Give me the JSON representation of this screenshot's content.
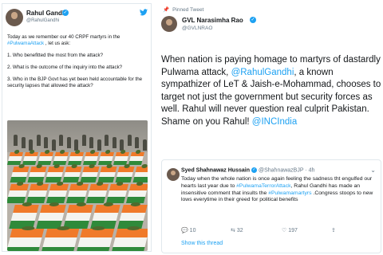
{
  "left_tweet": {
    "name": "Rahul Gandhi",
    "handle": "@RahulGandhi",
    "paragraphs": [
      [
        "Today as we remember our 40 CRPF martyrs in the ",
        "#PulwamaAttack",
        " , let us ask:"
      ],
      [
        "1. Who benefitted the most from the attack?"
      ],
      [
        "2. What is the outcome of the inquiry into the attack?"
      ],
      [
        "3. Who in the BJP Govt has yet been held accountable for the security lapses that allowed the attack?"
      ]
    ],
    "photo_description_icon": "coffins-photo",
    "colors": {
      "saffron": "#f07a2a",
      "white": "#f4f4f0",
      "green": "#2f8a3a"
    }
  },
  "right_tweet": {
    "pinned_label": "Pinned Tweet",
    "name": "GVL Narasimha Rao",
    "handle": "@GVLNRAO",
    "text_parts": [
      [
        "When nation is paying homage to martyrs of dastardly Pulwama attack, ",
        false
      ],
      [
        "@RahulGandhi",
        true
      ],
      [
        ", a known sympathizer of LeT & Jaish-e-Mohammad, chooses to target not just the government but security forces as well. Rahul will never question real culprit Pakistan.",
        false
      ],
      [
        "\nShame on you Rahul! ",
        false
      ],
      [
        "@INCIndia",
        true
      ]
    ],
    "quoted": {
      "name": "Syed Shahnawaz Hussain",
      "handle": "@ShahnawazBJP",
      "time": "· 4h",
      "text_parts": [
        [
          "Today when the whole nation is once again feeling the sadness tht engulfed our hearts last year due to ",
          false
        ],
        [
          "#PulwamaTerrorAttack",
          true
        ],
        [
          ", Rahul Gandhi has made an insensitive comment that insults the ",
          false
        ],
        [
          "#Pulwamamartyrs",
          true
        ],
        [
          " .Congress stoops to new lows everytime in their greed for political benefits",
          false
        ]
      ],
      "replies": "10",
      "retweets": "32",
      "likes": "197",
      "show_thread": "Show this thread"
    }
  }
}
